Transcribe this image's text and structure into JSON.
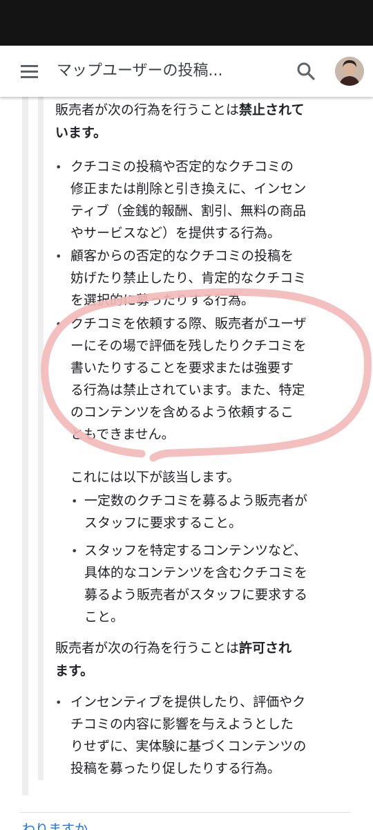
{
  "app_bar": {
    "title": "マップユーザーの投稿...",
    "menu_icon": "hamburger-menu-icon",
    "search_icon": "search-icon",
    "avatar": "user-avatar"
  },
  "section_prohibited": {
    "intro_prefix": "販売者が次の行為を行うことは",
    "intro_bold_1": "禁止されて",
    "intro_bold_2": "います。",
    "items": [
      {
        "lines": [
          "クチコミの投稿や否定的なクチコミの",
          "修正または削除と引き換えに、インセン",
          "ティブ（金銭的報酬、割引、無料の商品",
          "やサービスなど）を提供する行為。"
        ]
      },
      {
        "lines": [
          "顧客からの否定的なクチコミの投稿を",
          "妨げたり禁止したり、肯定的なクチコミ",
          "を選択的に募ったりする行為。"
        ]
      },
      {
        "lines": [
          "クチコミを依頼する際、販売者がユーザ",
          "ーにその場で評価を残したりクチコミを",
          "書いたりすることを要求または強要す",
          "る行為は禁止されています。また、特定",
          "のコンテンツを含めるよう依頼するこ",
          "ともできません。"
        ]
      }
    ],
    "applies_intro": "これには以下が該当します。",
    "sub_items": [
      {
        "lines": [
          "一定数のクチコミを募るよう販売者が",
          "スタッフに要求すること。"
        ]
      },
      {
        "lines": [
          "スタッフを特定するコンテンツなど、",
          "具体的なコンテンツを含むクチコミを",
          "募るよう販売者がスタッフに要求する",
          "こと。"
        ]
      }
    ]
  },
  "section_permitted": {
    "intro_prefix": "販売者が次の行為を行うことは",
    "intro_bold_1": "許可され",
    "intro_bold_2": "ます。",
    "items": [
      {
        "lines": [
          "インセンティブを提供したり、評価やク",
          "チコミの内容に影響を与えようとした",
          "りせずに、実体験に基づくコンテンツの",
          "投稿を募ったり促したりする行為。"
        ]
      }
    ]
  },
  "bottom": {
    "link_text": "わりますか"
  },
  "colors": {
    "annotation_circle": "#f2b8b8",
    "link": "#1a73e8"
  }
}
